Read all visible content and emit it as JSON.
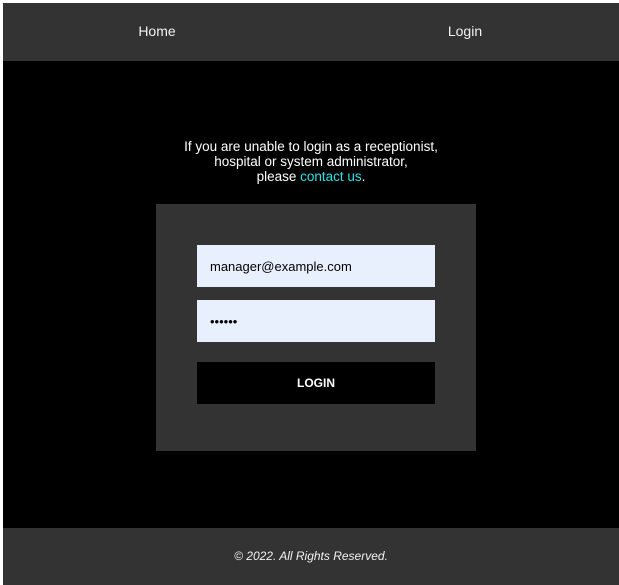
{
  "nav": {
    "home_label": "Home",
    "login_label": "Login"
  },
  "notice": {
    "line1": "If you are unable to login as a receptionist,",
    "line2": "hospital or system administrator,",
    "line3_prefix": "please ",
    "contact_link": "contact us",
    "line3_suffix": "."
  },
  "login_form": {
    "email_value": "manager@example.com",
    "password_value": "••••••",
    "submit_label": "LOGIN"
  },
  "footer": {
    "copyright": "© 2022. All Rights Reserved."
  },
  "colors": {
    "background": "#000000",
    "panel": "#333333",
    "input_fill": "#e8f0fe",
    "link": "#27e3e6"
  }
}
